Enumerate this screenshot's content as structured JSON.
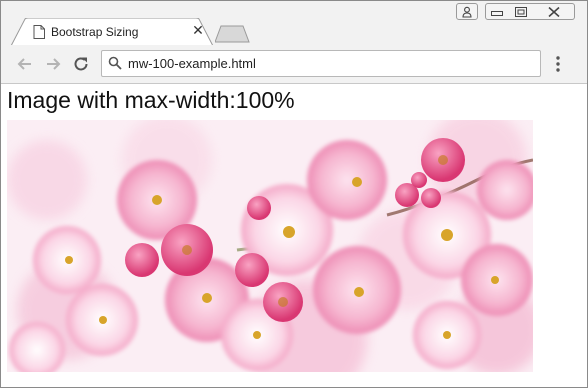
{
  "tab": {
    "title": "Bootstrap Sizing",
    "close_glyph": "✕"
  },
  "toolbar": {
    "back_icon": "arrow-left-icon",
    "forward_icon": "arrow-right-icon",
    "reload_icon": "reload-icon",
    "address": "mw-100-example.html",
    "menu_icon": "vertical-dots-icon"
  },
  "page": {
    "heading": "Image with max-width:100%",
    "image_subject": "pink cherry blossoms"
  },
  "colors": {
    "chrome": "#f2f2f2",
    "blossom_pink": "#f49ac1",
    "blossom_deep": "#e0457b",
    "stamen": "#d8a42a"
  }
}
